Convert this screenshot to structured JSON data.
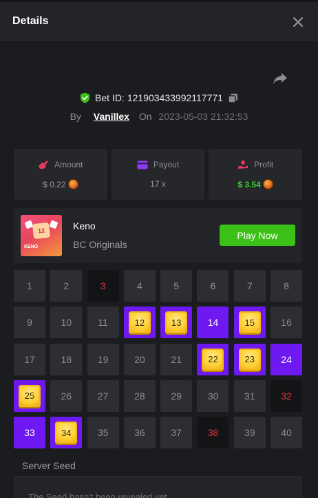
{
  "header": {
    "title": "Details"
  },
  "bet": {
    "id_label": "Bet ID:",
    "id": "121903433992117771",
    "by_label": "By",
    "user": "Vanillex",
    "on_label": "On",
    "date": "2023-05-03 21:32:53"
  },
  "stats": {
    "amount": {
      "label": "Amount",
      "value": "$ 0.22"
    },
    "payout": {
      "label": "Payout",
      "value": "17 x"
    },
    "profit": {
      "label": "Profit",
      "value": "$ 3.54",
      "color": "#3bd130"
    }
  },
  "game": {
    "thumb_name": "KENO",
    "thumb_ball": "12",
    "name": "Keno",
    "provider": "BC Originals",
    "play_label": "Play Now"
  },
  "keno": {
    "numbers": [
      "1",
      "2",
      "3",
      "4",
      "5",
      "6",
      "7",
      "8",
      "9",
      "10",
      "11",
      "12",
      "13",
      "14",
      "15",
      "16",
      "17",
      "18",
      "19",
      "20",
      "21",
      "22",
      "23",
      "24",
      "25",
      "26",
      "27",
      "28",
      "29",
      "30",
      "31",
      "32",
      "33",
      "34",
      "35",
      "36",
      "37",
      "38",
      "39",
      "40"
    ],
    "hits": [
      12,
      13,
      15,
      22,
      23,
      25,
      34
    ],
    "picked_no_hit": [
      14,
      24,
      33
    ],
    "drawn_misses": [
      3,
      32,
      38
    ],
    "colors": {
      "picked": "#6f19f2",
      "miss_text": "#e0313b",
      "gem": "#ffcf33"
    }
  },
  "seed": {
    "label": "Server Seed",
    "text": "The Seed hasn't been revealed yet"
  }
}
